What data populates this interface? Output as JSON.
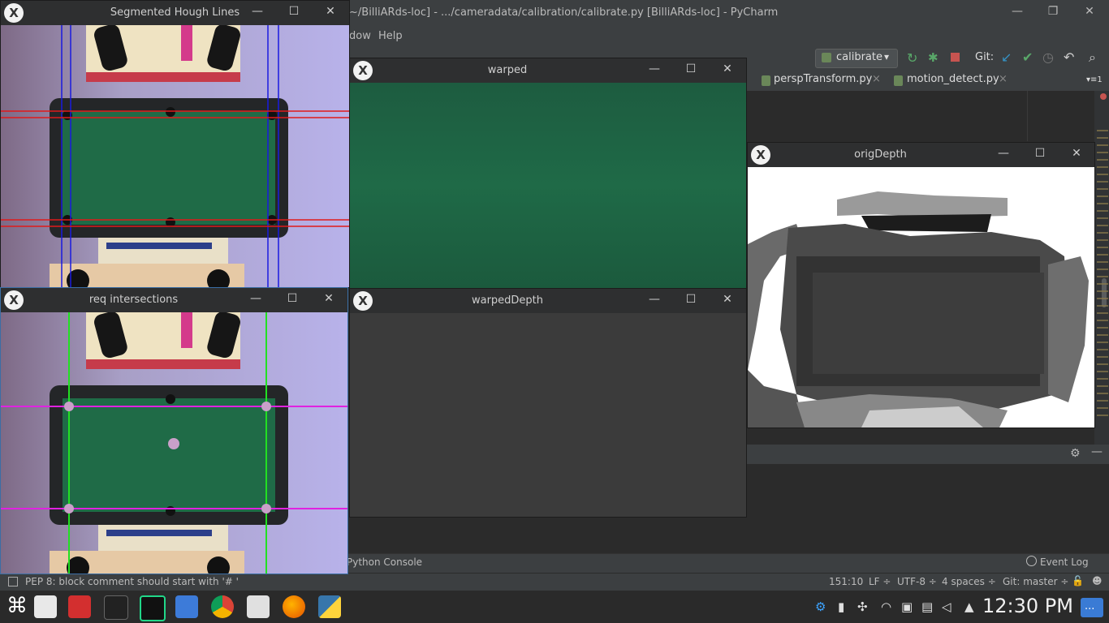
{
  "pycharm": {
    "title": "~/BilliARds-loc] - .../cameradata/calibration/calibrate.py [BilliARds-loc] - PyCharm",
    "window_controls": {
      "minimize": "—",
      "maximize": "❐",
      "close": "✕"
    },
    "menu": [
      "dow",
      "Help"
    ],
    "toolbar": {
      "run_config": "calibrate",
      "run_config_arrow": "▾",
      "git_label": "Git:",
      "icons": [
        "rerun-icon",
        "debug-icon",
        "stop-icon",
        "git-update-icon",
        "git-commit-icon",
        "history-icon",
        "revert-icon",
        "search-icon"
      ]
    },
    "tabs": [
      {
        "label": "perspTransform.py",
        "close": "×"
      },
      {
        "label": "motion_detect.py",
        "close": "×"
      }
    ],
    "tab_overflow": "▾≡1",
    "bottom_tools": {
      "python_console": "Python Console",
      "event_log": "Event Log"
    },
    "status": {
      "message": "PEP 8: block comment should start with '# '",
      "position": "151:10",
      "line_sep": "LF ÷",
      "encoding": "UTF-8 ÷",
      "indent": "4 spaces ÷",
      "git_branch": "Git: master ÷"
    }
  },
  "cv_windows": {
    "hough": {
      "title": "Segmented Hough Lines"
    },
    "intersections": {
      "title": "req intersections"
    },
    "warped": {
      "title": "warped"
    },
    "warped_depth": {
      "title": "warpedDepth"
    },
    "orig_depth": {
      "title": "origDepth"
    },
    "controls": {
      "minimize": "—",
      "maximize": "☐",
      "close": "✕"
    }
  },
  "taskbar": {
    "apps": [
      "launcher-icon",
      "desktop-icon",
      "pdf-icon",
      "terminal-icon",
      "pycharm-icon",
      "files-icon",
      "chrome-icon",
      "sublime-icon",
      "firefox-icon",
      "python-icon"
    ],
    "clock": "12:30 PM",
    "show_desktop": "..."
  },
  "colors": {
    "ide_bg": "#2b2b2b",
    "ide_panel": "#3c3f41",
    "felt_green": "#1e6b3f",
    "taskbar": "#2a2a2a"
  }
}
